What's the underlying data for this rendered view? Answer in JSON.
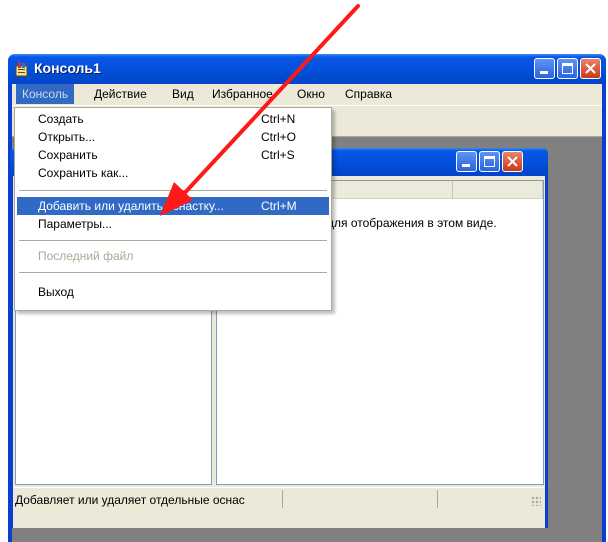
{
  "window": {
    "title": "Консоль1",
    "icon": "console-app-icon"
  },
  "menubar": {
    "items": [
      "Консоль",
      "Действие",
      "Вид",
      "Избранное",
      "Окно",
      "Справка"
    ],
    "active_index": 0
  },
  "dropdown": {
    "items": [
      {
        "label": "Создать",
        "shortcut": "Ctrl+N"
      },
      {
        "label": "Открыть...",
        "shortcut": "Ctrl+O"
      },
      {
        "label": "Сохранить",
        "shortcut": "Ctrl+S"
      },
      {
        "label": "Сохранить как...",
        "shortcut": ""
      },
      {
        "label": "Добавить или удалить оснастку...",
        "shortcut": "Ctrl+M",
        "highlighted": true
      },
      {
        "label": "Параметры...",
        "shortcut": ""
      },
      {
        "label": "Последний файл",
        "shortcut": "",
        "disabled": true
      },
      {
        "label": "Выход",
        "shortcut": ""
      }
    ]
  },
  "list_pane": {
    "empty_message": "для отображения в этом виде."
  },
  "statusbar": {
    "text": "Добавляет или удаляет отдельные оснас"
  },
  "colors": {
    "titlebar": "#0250dc",
    "menu_highlight": "#316ac5",
    "arrow": "#ff1a1a",
    "window_face": "#ece9d8"
  }
}
